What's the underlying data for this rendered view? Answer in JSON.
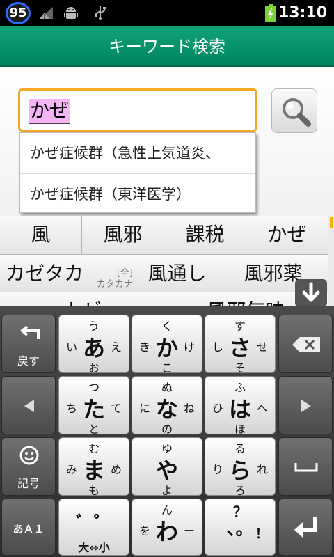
{
  "status_bar": {
    "badge_count": "95",
    "time": "13:10",
    "icons": [
      "signal-warning-icon",
      "android-debug-icon",
      "usb-icon",
      "battery-charging-icon"
    ],
    "colors": {
      "badge_ring": "#2a6cff",
      "battery": "#7bd13a"
    }
  },
  "title_bar": {
    "title": "キーワード検索",
    "color": "#0a9670"
  },
  "search": {
    "input_value": "かぜ",
    "suggestions": [
      "かぜ症候群（急性上気道炎、",
      "かぜ症候群（東洋医学）"
    ],
    "button_icon": "magnifier-icon",
    "accent": "#f5a623"
  },
  "candidates": {
    "row1": [
      "風",
      "風邪",
      "課税",
      "かぜ"
    ],
    "row2": [
      {
        "label": "カゼタカ",
        "sub_top": "[全]",
        "sub_bottom": "カタカナ"
      },
      {
        "label": "風通し"
      },
      {
        "label": "風邪薬"
      }
    ],
    "row3": [
      "カゼ",
      "風邪気味"
    ],
    "expand_icon": "arrow-down-icon"
  },
  "keyboard": {
    "left_keys": [
      {
        "icon": "undo-arrow-icon",
        "label": "戻す"
      },
      {
        "icon": "arrow-left-icon",
        "label": ""
      },
      {
        "icon": "smiley-icon",
        "label": "記号"
      },
      {
        "icon": "",
        "label": "あＡ１"
      }
    ],
    "right_keys": [
      {
        "icon": "backspace-icon"
      },
      {
        "icon": "arrow-right-icon"
      },
      {
        "icon": "space-icon"
      },
      {
        "icon": "enter-icon"
      }
    ],
    "kana_keys": [
      {
        "main": "あ",
        "up": "う",
        "left": "い",
        "right": "え",
        "down": "お"
      },
      {
        "main": "か",
        "up": "く",
        "left": "き",
        "right": "け",
        "down": "こ"
      },
      {
        "main": "さ",
        "up": "す",
        "left": "し",
        "right": "せ",
        "down": "そ"
      },
      {
        "main": "た",
        "up": "つ",
        "left": "ち",
        "right": "て",
        "down": "と"
      },
      {
        "main": "な",
        "up": "ぬ",
        "left": "に",
        "right": "ね",
        "down": "の"
      },
      {
        "main": "は",
        "up": "ふ",
        "left": "ひ",
        "right": "へ",
        "down": "ほ"
      },
      {
        "main": "ま",
        "up": "む",
        "left": "み",
        "right": "め",
        "down": "も"
      },
      {
        "main": "や",
        "up": "ゆ",
        "left": "",
        "right": "",
        "down": "よ"
      },
      {
        "main": "ら",
        "up": "る",
        "left": "り",
        "right": "れ",
        "down": "ろ"
      },
      {
        "main": "゛゜",
        "up": "",
        "left": "",
        "right": "",
        "down": "大⇔小"
      },
      {
        "main": "わ",
        "up": "ん",
        "left": "を",
        "right": "ー",
        "down": ""
      },
      {
        "main": "、。",
        "up": "？",
        "left": "",
        "right": "",
        "down": "！"
      }
    ]
  }
}
